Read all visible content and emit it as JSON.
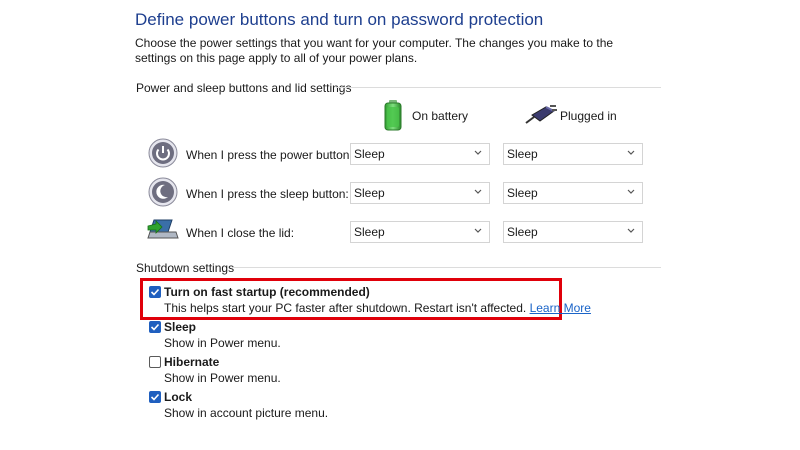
{
  "header": {
    "title": "Define power buttons and turn on password protection",
    "description": "Choose the power settings that you want for your computer. The changes you make to the settings on this page apply to all of your power plans."
  },
  "power_section": {
    "title": "Power and sleep buttons and lid settings",
    "columns": {
      "battery": "On battery",
      "plugged": "Plugged in"
    },
    "rows": [
      {
        "label": "When I press the power button:",
        "icon": "power-button-icon",
        "battery": "Sleep",
        "plugged": "Sleep"
      },
      {
        "label": "When I press the sleep button:",
        "icon": "sleep-button-icon",
        "battery": "Sleep",
        "plugged": "Sleep"
      },
      {
        "label": "When I close the lid:",
        "icon": "laptop-lid-icon",
        "battery": "Sleep",
        "plugged": "Sleep"
      }
    ]
  },
  "shutdown_section": {
    "title": "Shutdown settings",
    "options": [
      {
        "title": "Turn on fast startup (recommended)",
        "desc": "This helps start your PC faster after shutdown. Restart isn't affected.",
        "link": "Learn More",
        "checked": true
      },
      {
        "title": "Sleep",
        "desc": "Show in Power menu.",
        "checked": true
      },
      {
        "title": "Hibernate",
        "desc": "Show in Power menu.",
        "checked": false
      },
      {
        "title": "Lock",
        "desc": "Show in account picture menu.",
        "checked": true
      }
    ]
  },
  "colors": {
    "title": "#1e3f8f",
    "checkbox_checked": "#1f5fbf",
    "highlight": "#e0000a",
    "link": "#1a64c8"
  }
}
